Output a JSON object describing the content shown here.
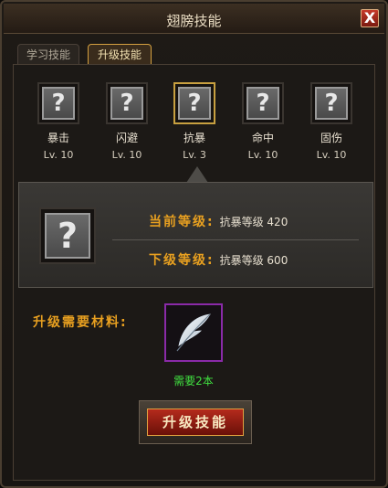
{
  "window": {
    "title": "翅膀技能",
    "close_label": "X"
  },
  "tabs": [
    {
      "label": "学习技能",
      "active": false
    },
    {
      "label": "升级技能",
      "active": true
    }
  ],
  "skills": [
    {
      "name": "暴击",
      "level": "Lv. 10",
      "icon": "unknown-question-icon",
      "selected": false
    },
    {
      "name": "闪避",
      "level": "Lv. 10",
      "icon": "unknown-question-icon",
      "selected": false
    },
    {
      "name": "抗暴",
      "level": "Lv. 3",
      "icon": "unknown-question-icon",
      "selected": true
    },
    {
      "name": "命中",
      "level": "Lv. 10",
      "icon": "unknown-question-icon",
      "selected": false
    },
    {
      "name": "固伤",
      "level": "Lv. 10",
      "icon": "unknown-question-icon",
      "selected": false
    }
  ],
  "detail": {
    "current_label": "当前等级:",
    "current_value": "抗暴等级 420",
    "next_label": "下级等级:",
    "next_value": "抗暴等级 600"
  },
  "materials": {
    "label": "升级需要材料:",
    "item_icon": "feather-icon",
    "count_text": "需要2本"
  },
  "upgrade_button": {
    "label": "升级技能"
  },
  "colors": {
    "accent_gold": "#e8a020",
    "material_green": "#40e040",
    "button_red": "#b42a1c",
    "rare_purple": "#8a2aa8"
  }
}
